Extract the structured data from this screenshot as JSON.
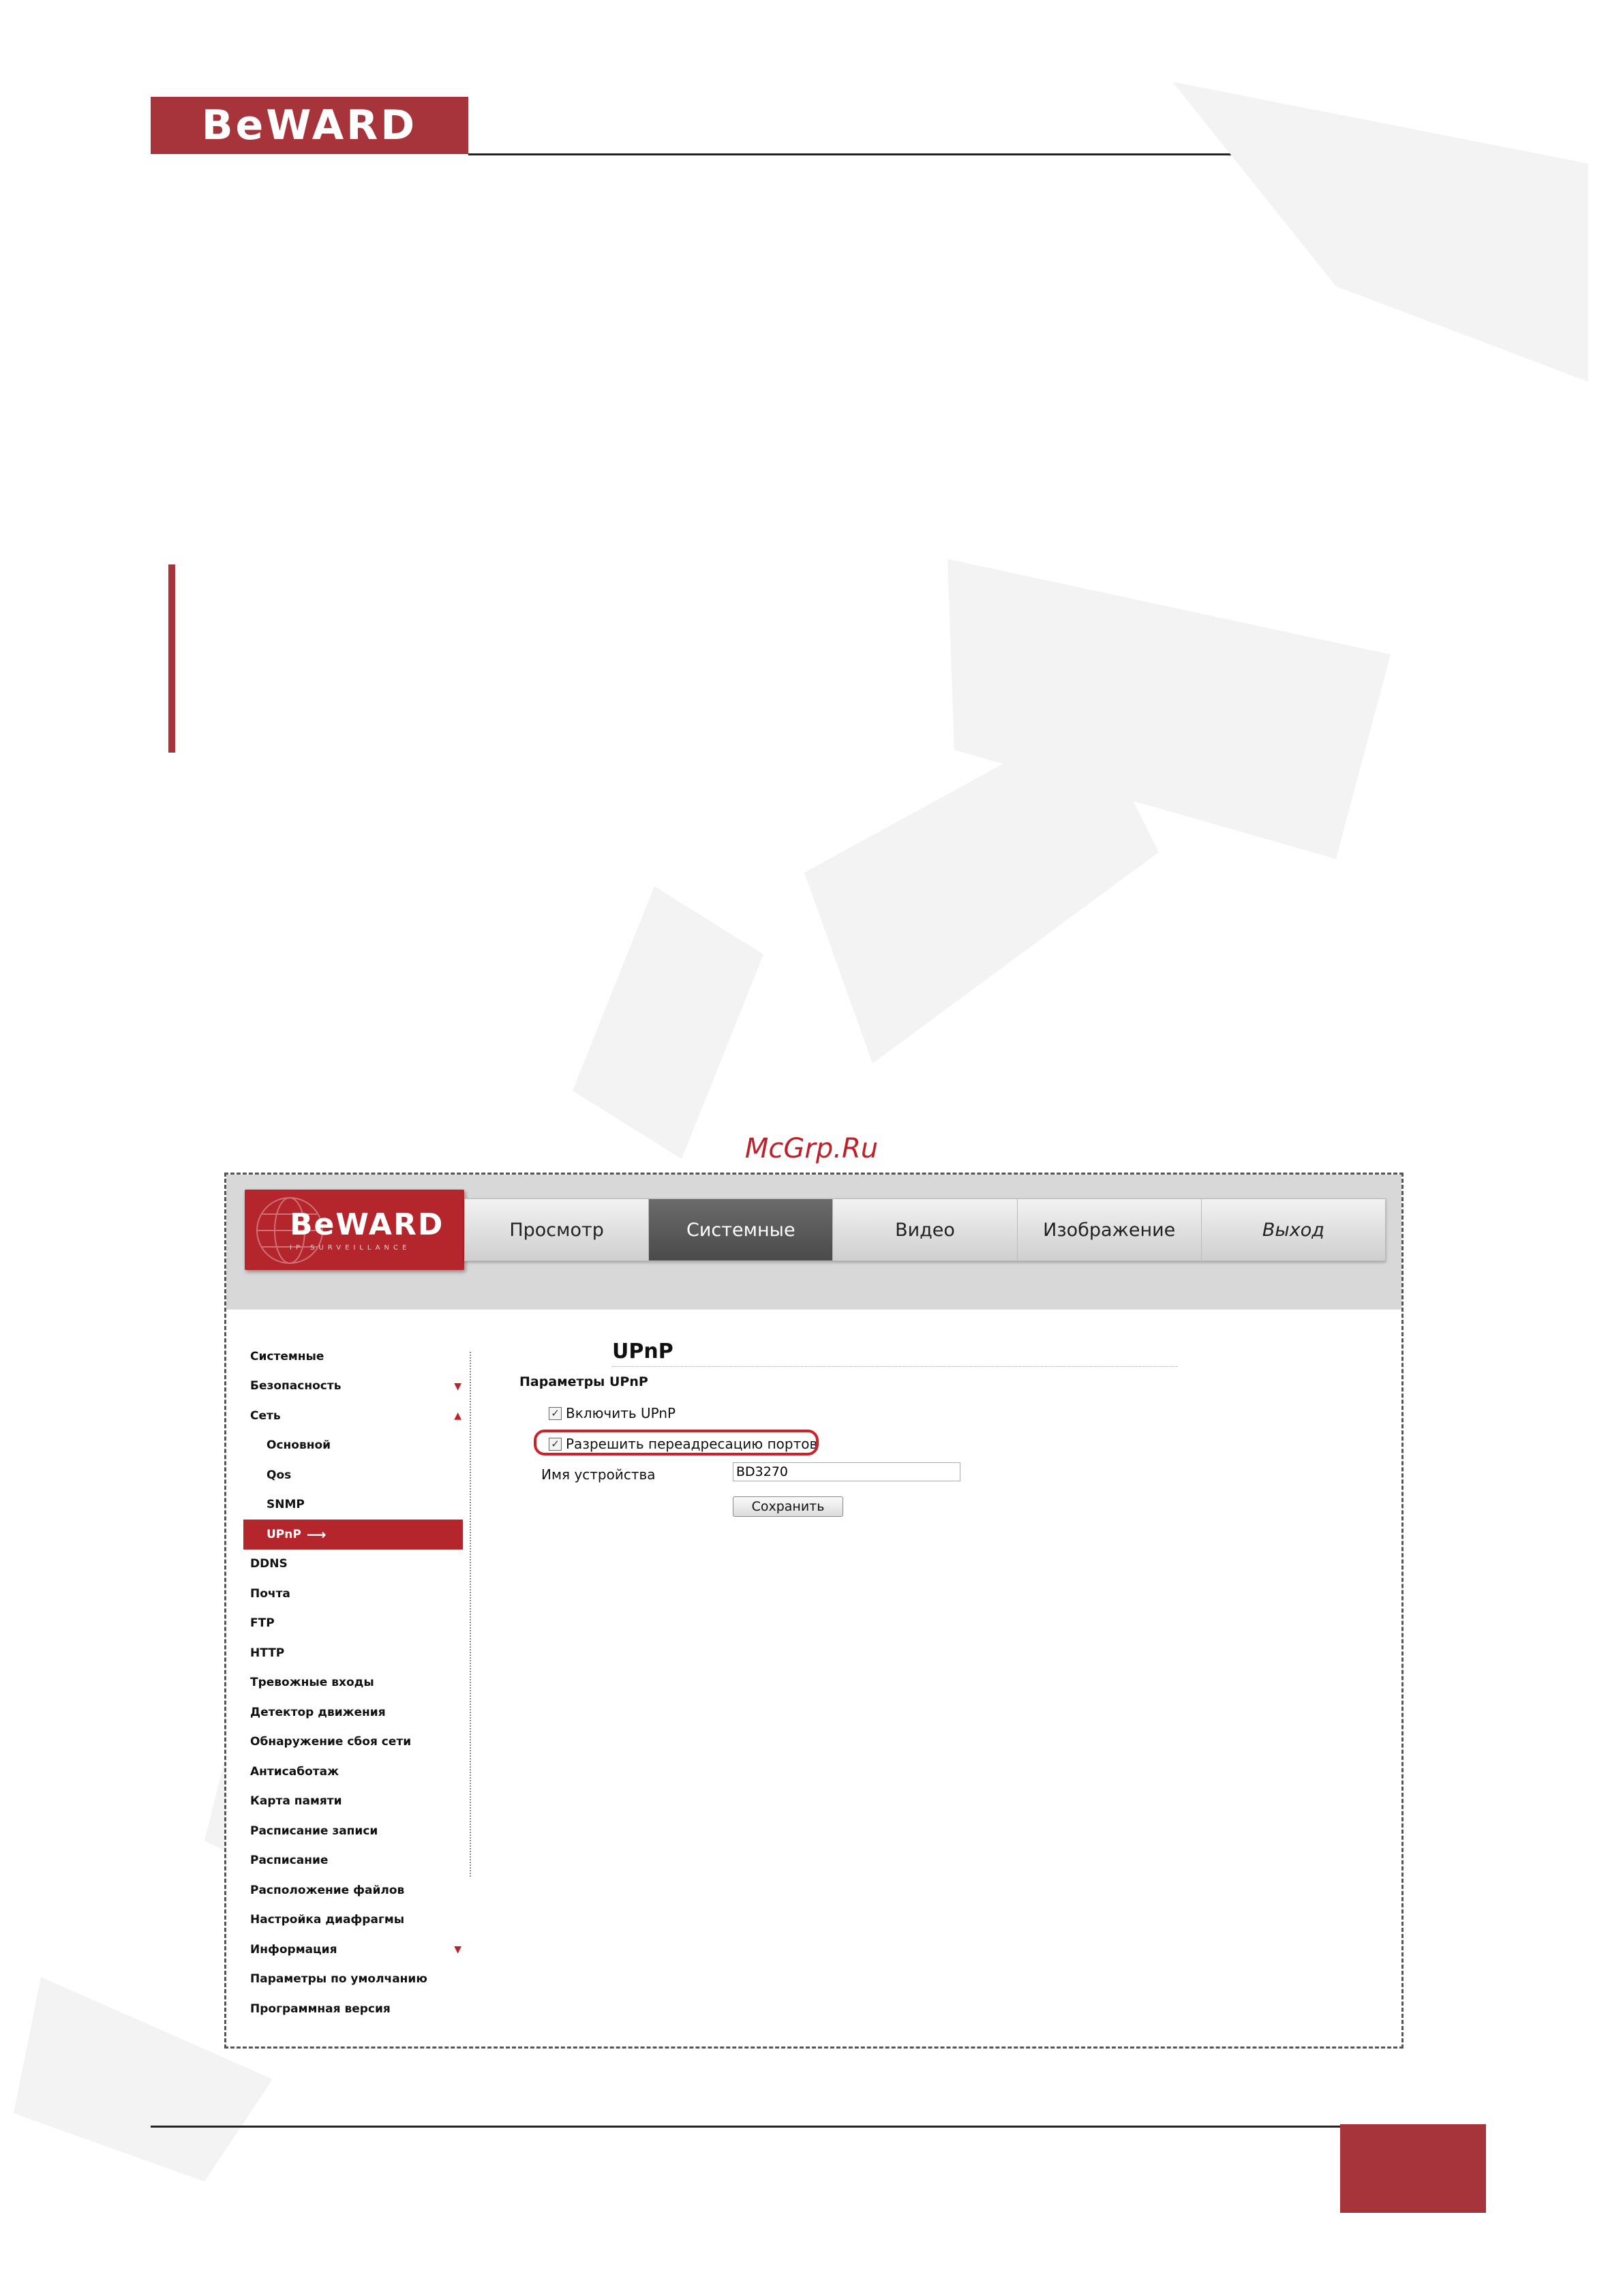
{
  "document": {
    "logo_text": "BeWARD",
    "caption": "McGrp.Ru"
  },
  "app": {
    "logo_text": "BeWARD",
    "logo_subtext": "IP SURVEILLANCE",
    "nav": [
      {
        "label": "Просмотр"
      },
      {
        "label": "Системные"
      },
      {
        "label": "Видео"
      },
      {
        "label": "Изображение"
      },
      {
        "label": "Выход"
      }
    ],
    "active_nav": "Системные"
  },
  "sidebar": {
    "items": [
      {
        "label": "Системные"
      },
      {
        "label": "Безопасность",
        "arrow": "▼"
      },
      {
        "label": "Сеть",
        "arrow": "▲"
      },
      {
        "label": "Основной"
      },
      {
        "label": "Qos"
      },
      {
        "label": "SNMP"
      },
      {
        "label": "UPnP",
        "pointer": "⟶"
      },
      {
        "label": "DDNS"
      },
      {
        "label": "Почта"
      },
      {
        "label": "FTP"
      },
      {
        "label": "HTTP"
      },
      {
        "label": "Тревожные входы"
      },
      {
        "label": "Детектор движения"
      },
      {
        "label": "Обнаружение сбоя сети"
      },
      {
        "label": "Антисаботаж"
      },
      {
        "label": "Карта памяти"
      },
      {
        "label": "Расписание записи"
      },
      {
        "label": "Расписание"
      },
      {
        "label": "Расположение файлов"
      },
      {
        "label": "Настройка диафрагмы"
      },
      {
        "label": "Информация",
        "arrow": "▼"
      },
      {
        "label": "Параметры по умолчанию"
      },
      {
        "label": "Программная версия"
      }
    ]
  },
  "upnp": {
    "title": "UPnP",
    "section": "Параметры UPnP",
    "enable_label": "Включить UPnP",
    "enable_checked": true,
    "port_forward_label": "Разрешить переадресацию портов",
    "port_forward_checked": true,
    "device_name_label": "Имя устройства",
    "device_name_value": "BD3270",
    "save_label": "Сохранить"
  }
}
